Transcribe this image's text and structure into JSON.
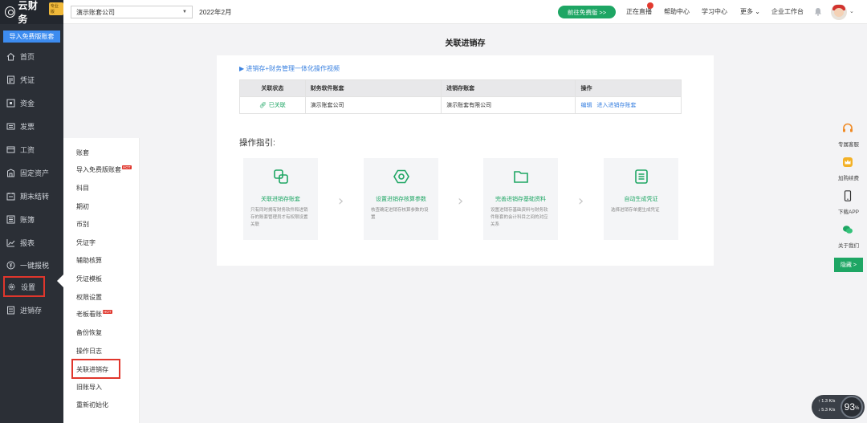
{
  "app": {
    "logo_text": "云财务",
    "logo_badge": "专业版"
  },
  "header": {
    "company": "演示账套公司",
    "period": "2022年2月",
    "free_button": "前往免费版 >>",
    "live": "正在直播",
    "help": "帮助中心",
    "learn": "学习中心",
    "more": "更多",
    "enterprise": "企业工作台"
  },
  "sidebar": {
    "import_button": "导入免费版账套",
    "items": [
      {
        "label": "首页",
        "icon": "home-icon"
      },
      {
        "label": "凭证",
        "icon": "voucher-icon"
      },
      {
        "label": "资金",
        "icon": "fund-icon"
      },
      {
        "label": "发票",
        "icon": "invoice-icon"
      },
      {
        "label": "工资",
        "icon": "salary-icon"
      },
      {
        "label": "固定资产",
        "icon": "asset-icon"
      },
      {
        "label": "期末结转",
        "icon": "closing-icon"
      },
      {
        "label": "账簿",
        "icon": "ledger-icon"
      },
      {
        "label": "报表",
        "icon": "report-icon"
      },
      {
        "label": "一键报税",
        "icon": "tax-icon"
      },
      {
        "label": "设置",
        "icon": "gear-icon"
      },
      {
        "label": "进销存",
        "icon": "inventory-icon"
      }
    ]
  },
  "submenu": {
    "items": [
      "账套",
      "导入免费版账套",
      "科目",
      "期初",
      "币别",
      "凭证字",
      "辅助核算",
      "凭证模板",
      "权限设置",
      "老板看账",
      "备份恢复",
      "操作日志",
      "关联进销存",
      "旧账导入",
      "重新初始化"
    ],
    "hot_label": "HOT"
  },
  "main": {
    "title": "关联进销存",
    "video_link": "▶ 进销存+财务管理一体化操作视频",
    "table": {
      "headers": [
        "关联状态",
        "财务软件账套",
        "进销存账套",
        "操作"
      ],
      "row": {
        "status": "已关联",
        "finance_book": "演示账套公司",
        "inventory_book": "演示账套有限公司",
        "edit": "编辑",
        "enter": "进入进销存账套"
      }
    },
    "guide_title": "操作指引:",
    "steps": [
      {
        "title": "关联进销存账套",
        "desc": "只有同时拥有财务软件和进销存的账套管理员才有权限设置关联",
        "icon": "link-icon"
      },
      {
        "title": "设置进销存核算参数",
        "desc": "核查确定进销存核算参数的设置",
        "icon": "settings-hex-icon"
      },
      {
        "title": "完善进销存基础资料",
        "desc": "设置进销存基础资料与财务软件账套的会计科目之间的对应关系",
        "icon": "folder-icon"
      },
      {
        "title": "自动生成凭证",
        "desc": "选择进销存单据生成凭证",
        "icon": "document-icon"
      }
    ]
  },
  "float_panel": {
    "items": [
      "专属客服",
      "加购续费",
      "下载APP",
      "关于我们"
    ],
    "hide": "隐藏 >"
  },
  "speed": {
    "up": "1.3",
    "down": "5.3",
    "unit": "K/s",
    "value": "93"
  },
  "colors": {
    "accent_green": "#1ea664",
    "sidebar_bg": "#2b2f36",
    "link_blue": "#3b82e0",
    "highlight_red": "#e0362c"
  }
}
